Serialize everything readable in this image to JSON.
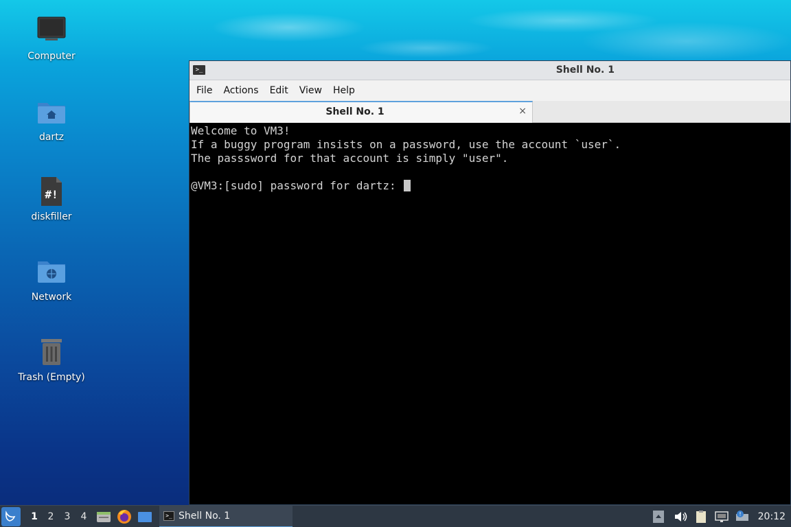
{
  "desktop": {
    "icons": [
      {
        "label": "Computer"
      },
      {
        "label": "dartz"
      },
      {
        "label": "diskfiller"
      },
      {
        "label": "Network"
      },
      {
        "label": "Trash (Empty)"
      }
    ]
  },
  "window": {
    "title": "Shell No. 1",
    "menu": [
      "File",
      "Actions",
      "Edit",
      "View",
      "Help"
    ],
    "tab": {
      "label": "Shell No. 1",
      "close": "×"
    },
    "terminal": {
      "lines": [
        "Welcome to VM3!",
        "If a buggy program insists on a password, use the account `user`.",
        "The passsword for that account is simply \"user\".",
        "",
        "@VM3:[sudo] password for dartz: "
      ]
    }
  },
  "taskbar": {
    "workspaces": [
      "1",
      "2",
      "3",
      "4"
    ],
    "active_workspace": "1",
    "launchers": [
      "file-manager-icon",
      "firefox-icon",
      "desktop-icon"
    ],
    "task": {
      "label": "Shell No. 1"
    },
    "clock": "20:12"
  },
  "colors": {
    "accent": "#5da1dc",
    "taskbar": "#2d3743",
    "terminal_bg": "#000000",
    "terminal_fg": "#d4d4d4"
  }
}
